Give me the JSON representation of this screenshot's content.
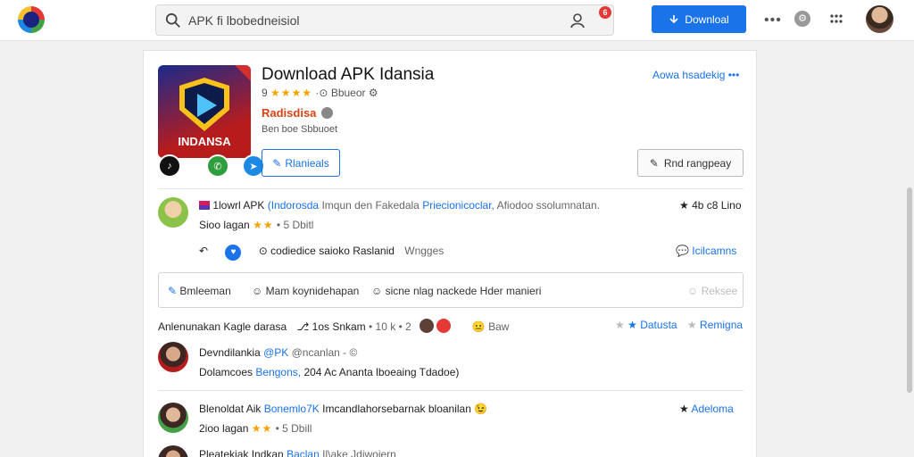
{
  "topbar": {
    "search_text": "APK fi lbobedneisiol",
    "notif_count": "6",
    "download_label": "Downloal",
    "dots": "•••"
  },
  "app": {
    "icon_label": "INDANSA",
    "title": "Download APK Idansia",
    "rating_num": "9",
    "rating_stars": "★★★★",
    "rating_text": "Bbueor",
    "tag": "Radisdisa",
    "sub": "Ben boe Sbbuoet",
    "install_label": "Rlanieals",
    "header_link": "Aowa hsadekig •••",
    "report_label": "Rnd rangpeay"
  },
  "post1": {
    "name": "1lowrl APK",
    "link1": "(Indorosda",
    "mid": "Imqun den Fakedala",
    "link2": "Priecionicoclar,",
    "tail": "Afiodoo ssolumnatan.",
    "meta_right": "4b c8 Lino",
    "line2": "Sioo lagan",
    "line2_stars": "★★",
    "line2_tail": "• 5 Dbitl",
    "action_text": "codiedice saioko Raslanid",
    "action_muted": "Wngges",
    "action_right": "Icilcamns"
  },
  "composer": {
    "label": "Bmleeman",
    "text2": "Mam koynidehapan",
    "text3": "sicne nlag nackede Hder manieri",
    "right": "Reksee"
  },
  "comments_bar": {
    "label": "Anlenunakan Kagle darasa",
    "text2": "1os Snkam",
    "text3": "• 10 k • 2",
    "text4": "Baw",
    "right1": "Datusta",
    "right2": "Remigna"
  },
  "comment1": {
    "name": "Devndilankia",
    "handle": "@PK",
    "meta": "@ncanlan - ©",
    "text_a": "Dolamcoes",
    "text_link": "Bengons,",
    "text_b": "204 Ac Ananta lboeaing Tdadoe)"
  },
  "comment2": {
    "name": "Blenoldat Aik",
    "link": "Bonemlo7K",
    "text": "Imcandlahorsebarnak bloanilan",
    "right": "Adeloma",
    "line2": "2ioo lagan",
    "line2_stars": "★★",
    "line2_tail": "• 5 Dbill"
  },
  "comment3": {
    "name": "Pleatekiak Indkan",
    "link": "Baclan",
    "text": "Il\\ake Jdiwoiern"
  },
  "colors": {
    "accent": "#1a73e8",
    "star": "#f4a300",
    "tag": "#d84315"
  }
}
